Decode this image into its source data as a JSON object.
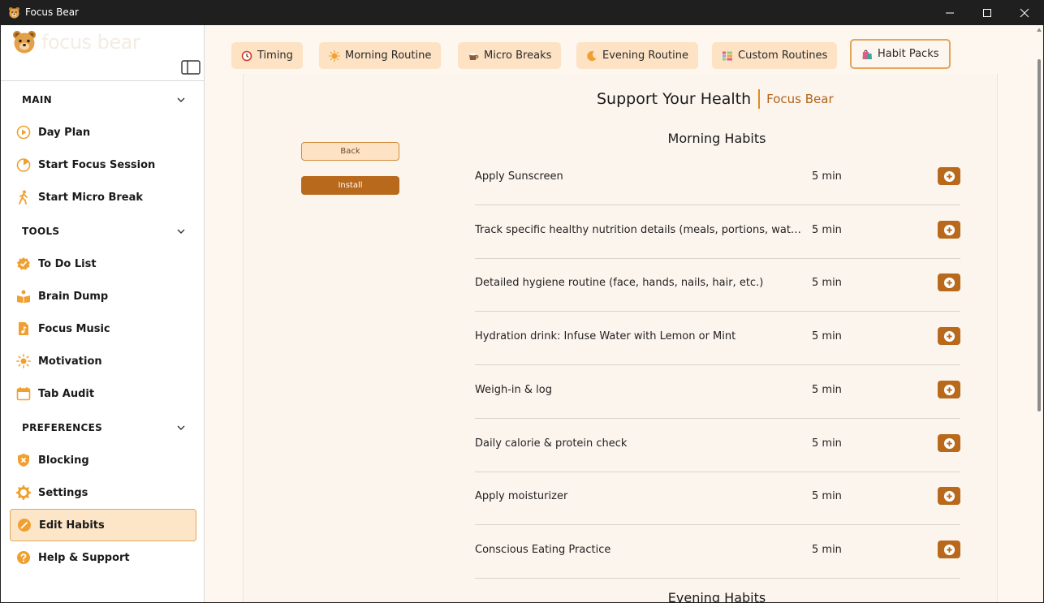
{
  "window": {
    "title": "Focus Bear"
  },
  "sidebar": {
    "logo_text": "focus bear",
    "sections": {
      "main": "MAIN",
      "tools": "TOOLS",
      "preferences": "PREFERENCES"
    },
    "items": {
      "day_plan": "Day Plan",
      "start_focus": "Start Focus Session",
      "micro_break": "Start Micro Break",
      "todo": "To Do List",
      "brain_dump": "Brain Dump",
      "focus_music": "Focus Music",
      "motivation": "Motivation",
      "tab_audit": "Tab Audit",
      "blocking": "Blocking",
      "settings": "Settings",
      "edit_habits": "Edit Habits",
      "help": "Help & Support"
    }
  },
  "tabs": [
    {
      "label": "Timing",
      "icon": "clock-icon"
    },
    {
      "label": "Morning Routine",
      "icon": "sun-icon"
    },
    {
      "label": "Micro Breaks",
      "icon": "coffee-icon"
    },
    {
      "label": "Evening Routine",
      "icon": "moon-icon"
    },
    {
      "label": "Custom Routines",
      "icon": "list-icon"
    },
    {
      "label": "Habit Packs",
      "icon": "shopping-bags-icon",
      "active": true
    }
  ],
  "pack": {
    "title": "Support Your Health",
    "author": "Focus Bear",
    "back_label": "Back",
    "install_label": "Install"
  },
  "groups": {
    "morning": "Morning Habits",
    "evening": "Evening Habits"
  },
  "habits": [
    {
      "name": "Apply Sunscreen",
      "duration": "5 min"
    },
    {
      "name": "Track specific healthy nutrition details (meals, portions, water intake)",
      "duration": "5 min"
    },
    {
      "name": "Detailed hygiene routine (face, hands, nails, hair, etc.)",
      "duration": "5 min"
    },
    {
      "name": "Hydration drink: Infuse Water with Lemon or Mint",
      "duration": "5 min"
    },
    {
      "name": "Weigh-in & log",
      "duration": "5 min"
    },
    {
      "name": "Daily calorie & protein check",
      "duration": "5 min"
    },
    {
      "name": "Apply moisturizer",
      "duration": "5 min"
    },
    {
      "name": "Conscious Eating Practice",
      "duration": "5 min"
    }
  ],
  "colors": {
    "accent": "#b8691c",
    "accent_light": "#fde2c4",
    "icon_orange": "#f0a030",
    "background": "#fdf7f0"
  }
}
